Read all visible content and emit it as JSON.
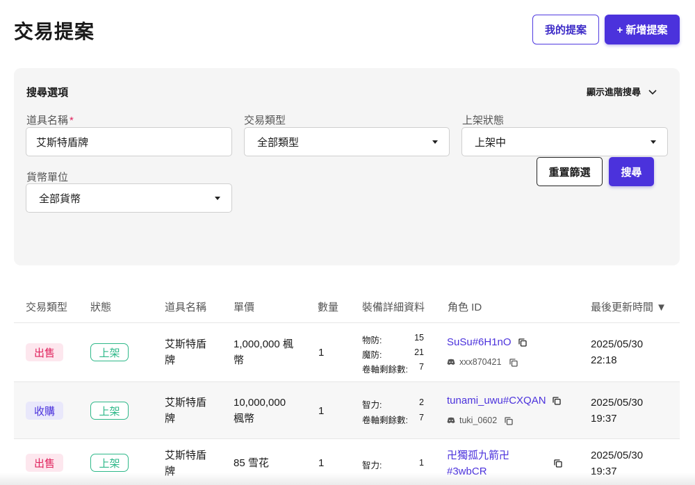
{
  "header": {
    "title": "交易提案",
    "my_proposals_label": "我的提案",
    "new_proposal_label": "+ 新增提案"
  },
  "search": {
    "heading": "搜尋選項",
    "advanced_label": "顯示進階搜尋",
    "item_name": {
      "label": "道具名稱",
      "required_mark": "*",
      "value": "艾斯特盾牌"
    },
    "trade_type": {
      "label": "交易類型",
      "value": "全部類型"
    },
    "listing_status": {
      "label": "上架狀態",
      "value": "上架中"
    },
    "currency": {
      "label": "貨幣單位",
      "value": "全部貨幣"
    },
    "reset_label": "重置篩選",
    "search_label": "搜尋"
  },
  "table": {
    "columns": [
      "交易類型",
      "狀態",
      "道具名稱",
      "單價",
      "數量",
      "裝備詳細資料",
      "角色 ID",
      "最後更新時間 ▼"
    ],
    "rows": [
      {
        "type": "出售",
        "status": "上架",
        "item": [
          "艾斯特盾",
          "牌"
        ],
        "price": [
          "1,000,000 楓",
          "幣"
        ],
        "qty": "1",
        "specs": [
          {
            "name": "物防:",
            "value": "15"
          },
          {
            "name": "魔防:",
            "value": "21"
          },
          {
            "name": "卷軸剩餘數:",
            "value": "7"
          }
        ],
        "character": [
          "SuSu#6H1nO"
        ],
        "discord": "xxx870421",
        "updated": [
          "2025/05/30",
          "22:18"
        ]
      },
      {
        "type": "收購",
        "status": "上架",
        "item": [
          "艾斯特盾",
          "牌"
        ],
        "price": [
          "10,000,000",
          "楓幣"
        ],
        "qty": "1",
        "specs": [
          {
            "name": "智力:",
            "value": "2"
          },
          {
            "name": "卷軸剩餘數:",
            "value": "7"
          }
        ],
        "character": [
          "tunami_uwu#CXQAN"
        ],
        "discord": "tuki_0602",
        "updated": [
          "2025/05/30",
          "19:37"
        ]
      },
      {
        "type": "出售",
        "status": "上架",
        "item": [
          "艾斯特盾",
          "牌"
        ],
        "price": [
          "85 雪花"
        ],
        "qty": "1",
        "specs": [
          {
            "name": "智力:",
            "value": "1"
          }
        ],
        "character": [
          "卍獨孤九箭卍",
          "#3wbCR"
        ],
        "discord": "",
        "updated": [
          "2025/05/30",
          "19:37"
        ]
      }
    ]
  },
  "colors": {
    "primary": "#4b32dc",
    "sell": "#e0245e",
    "active": "#2eb889",
    "panel_bg": "#f5f5f5"
  }
}
